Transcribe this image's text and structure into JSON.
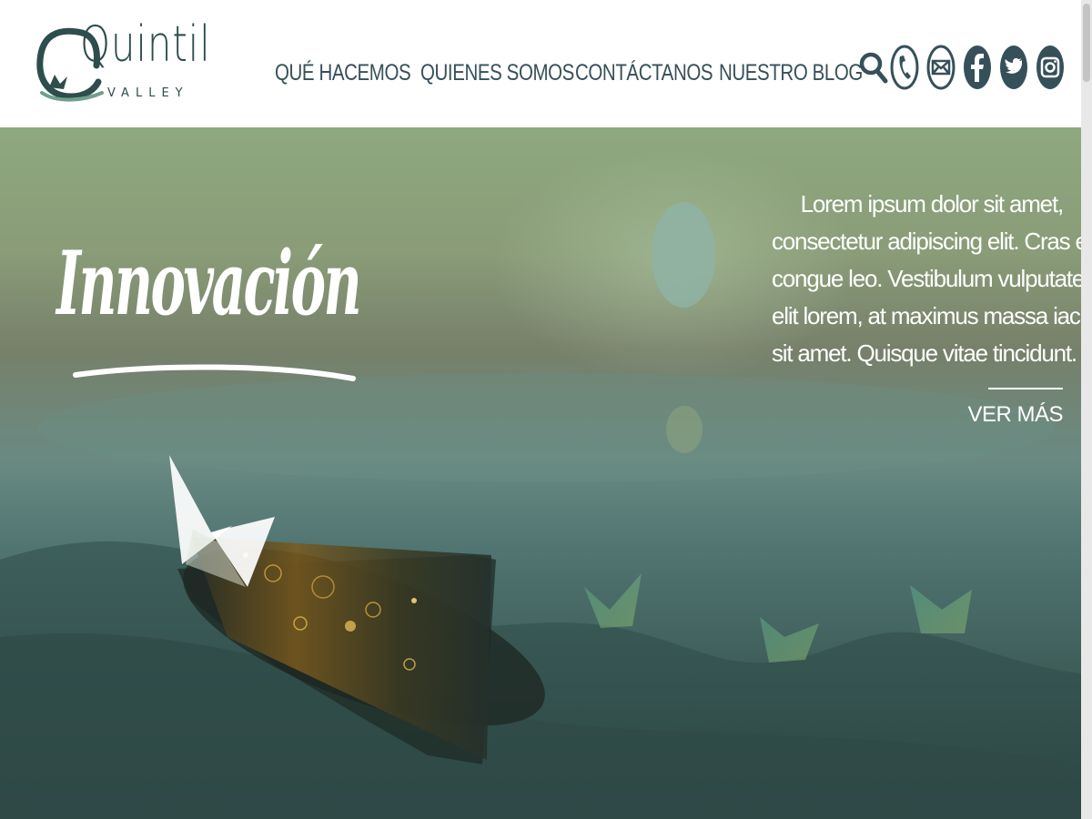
{
  "brand": {
    "name": "Quintil",
    "tagline": "VALLEY"
  },
  "nav": {
    "items": [
      {
        "label": "QUÉ HACEMOS"
      },
      {
        "label": "QUIENES SOMOS"
      },
      {
        "label": "CONTÁCTANOS"
      },
      {
        "label": "NUESTRO BLOG"
      }
    ]
  },
  "social": {
    "icons": [
      "search-icon",
      "phone-icon",
      "mail-icon",
      "facebook-icon",
      "twitter-icon",
      "instagram-icon"
    ]
  },
  "hero": {
    "headline": "Innovación",
    "blurb_lines": [
      "Lorem ipsum dolor sit amet,",
      "consectetur adipiscing elit. Cras et",
      "congue leo. Vestibulum vulputate",
      "elit lorem, at maximus massa iaculis",
      "sit amet. Quisque vitae tincidunt."
    ],
    "cta_label": "VER MÁS"
  },
  "colors": {
    "brand_dark": "#2e4d4d",
    "nav_text": "#36505a",
    "hero_text": "#ffffff"
  }
}
